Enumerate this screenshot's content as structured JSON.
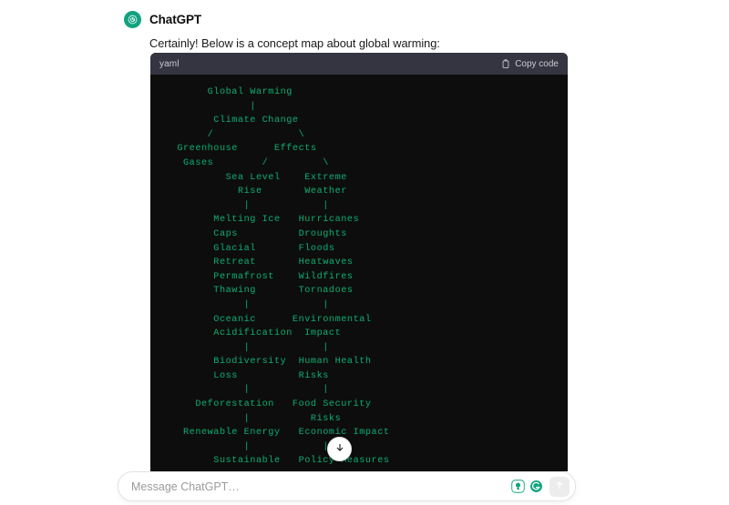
{
  "message": {
    "author": "ChatGPT",
    "avatar_icon": "openai-logo-icon",
    "text": "Certainly! Below is a concept map about global warming:"
  },
  "code_block": {
    "language": "yaml",
    "copy_label": "Copy code",
    "copy_icon": "clipboard-icon",
    "text_color": "#0fa36b",
    "background": "#0d0d0d",
    "header_background": "#343541",
    "content": "       Global Warming\n              |\n        Climate Change\n       /              \\\n  Greenhouse      Effects\n   Gases        /         \\\n          Sea Level    Extreme\n            Rise       Weather\n             |            |\n        Melting Ice   Hurricanes\n        Caps          Droughts\n        Glacial       Floods\n        Retreat       Heatwaves\n        Permafrost    Wildfires\n        Thawing       Tornadoes\n             |            |\n        Oceanic      Environmental\n        Acidification  Impact\n             |            |\n        Biodiversity  Human Health\n        Loss          Risks\n             |            |\n     Deforestation   Food Security\n             |          Risks\n   Renewable Energy   Economic Impact\n             |            |\n        Sustainable   Policy Measures"
  },
  "scroll_button": {
    "icon": "arrow-down-icon"
  },
  "composer": {
    "placeholder": "Message ChatGPT…",
    "value": "",
    "icons": [
      {
        "name": "lightbulb-icon"
      },
      {
        "name": "chatgpt-mark-icon"
      }
    ],
    "send_icon": "arrow-up-icon",
    "accent": "#10a37f"
  }
}
